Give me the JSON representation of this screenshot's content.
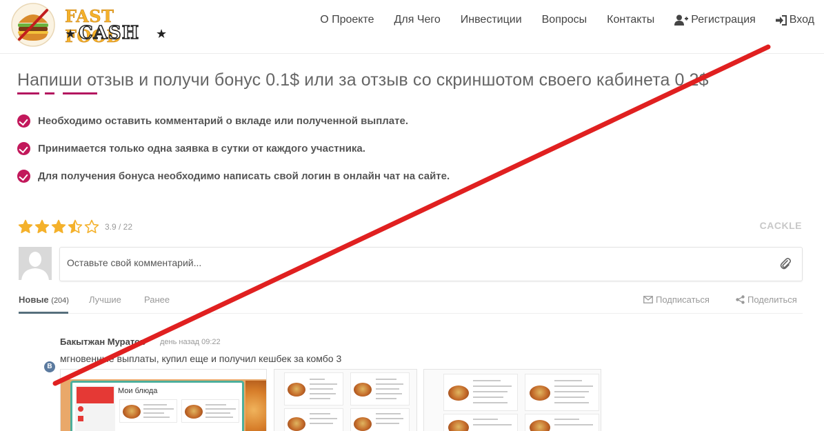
{
  "header": {
    "logo_line1": "FAST FOOD",
    "logo_line2": "CASH",
    "nav": [
      {
        "label": "О Проекте"
      },
      {
        "label": "Для Чего"
      },
      {
        "label": "Инвестиции"
      },
      {
        "label": "Вопросы"
      },
      {
        "label": "Контакты"
      },
      {
        "label": "Регистрация",
        "icon": "user-plus-icon"
      },
      {
        "label": "Вход",
        "icon": "sign-in-icon"
      }
    ]
  },
  "main": {
    "title": "Напиши отзыв и получи бонус 0.1$ или за отзыв со скриншотом своего кабинета 0.2$",
    "bullets": [
      "Необходимо оставить комментарий о вкладе или полученной выплате.",
      "Принимается только одна заявка в сутки от каждого участника.",
      "Для получения бонуса необходимо написать свой логин в онлайн чат на сайте."
    ]
  },
  "comments_widget": {
    "rating": {
      "stars": 3.5,
      "max_stars": 5,
      "text": "3.9 / 22"
    },
    "brand": "CACKLE",
    "input_placeholder": "Оставьте свой комментарий...",
    "tabs": [
      {
        "label": "Новые",
        "count": "(204)",
        "active": true
      },
      {
        "label": "Лучшие",
        "active": false
      },
      {
        "label": "Ранее",
        "active": false
      }
    ],
    "actions": {
      "subscribe": "Подписаться",
      "share": "Поделиться"
    },
    "comment": {
      "author": "Бакытжан Муратов",
      "time": "день назад 09:22",
      "text": "мгновенные выплаты, купил еще и получил кешбек за комбо 3",
      "network_badge": "B",
      "screenshot_title": "Мои блюда"
    }
  },
  "colors": {
    "accent": "#c2185b",
    "cross_line": "#e02020",
    "tab_active": "#566f7c",
    "logo_gold": "#f4b12b"
  }
}
